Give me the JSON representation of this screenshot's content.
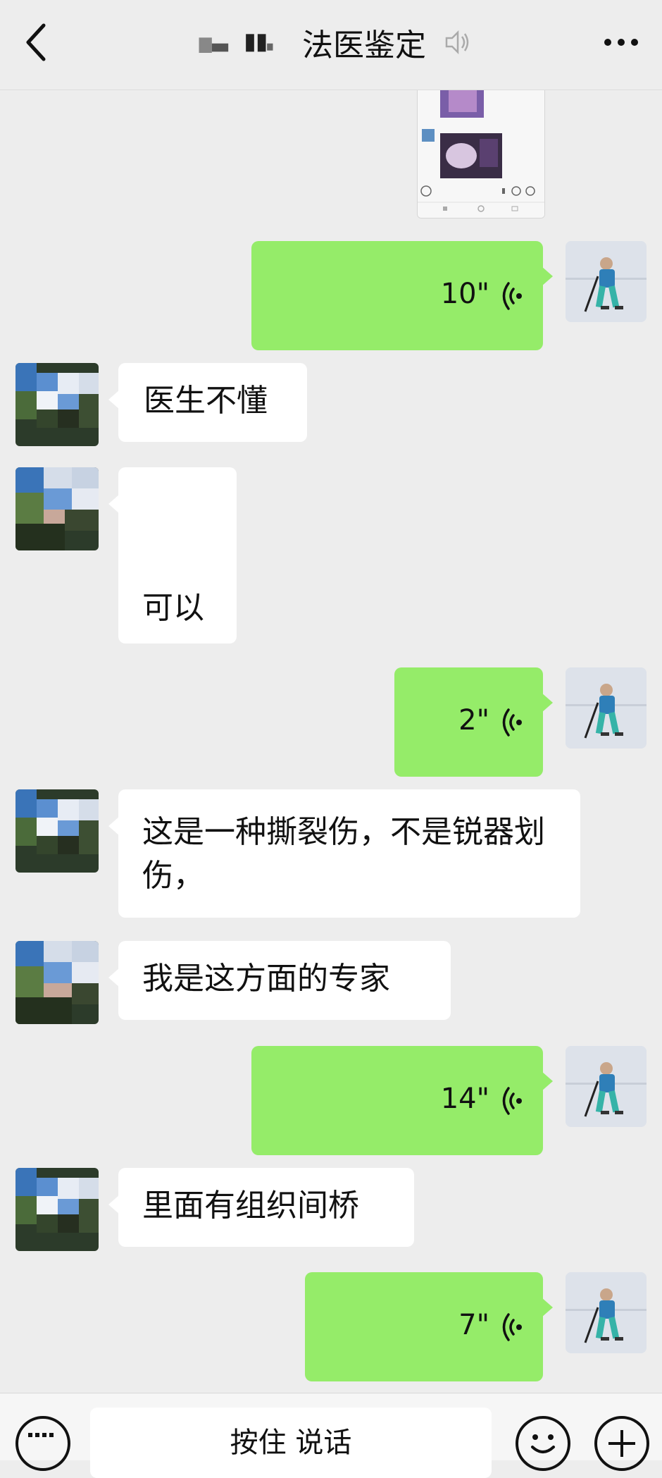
{
  "header": {
    "title": "法医鉴定",
    "back_icon": "chevron-left-icon",
    "mute_icon": "mute-icon",
    "more_icon": "more-icon"
  },
  "colors": {
    "background": "#ededed",
    "self_bubble": "#95ec69",
    "other_bubble": "#ffffff"
  },
  "messages": [
    {
      "side": "right",
      "type": "image"
    },
    {
      "side": "right",
      "type": "voice",
      "duration": "10\""
    },
    {
      "side": "left",
      "type": "text",
      "text": "医生不懂"
    },
    {
      "side": "left",
      "type": "text",
      "text": "可以"
    },
    {
      "side": "right",
      "type": "voice",
      "duration": "2\""
    },
    {
      "side": "left",
      "type": "text",
      "text": "这是一种撕裂伤，不是锐器划伤，"
    },
    {
      "side": "left",
      "type": "text",
      "text": "我是这方面的专家"
    },
    {
      "side": "right",
      "type": "voice",
      "duration": "14\""
    },
    {
      "side": "left",
      "type": "text",
      "text": "里面有组织间桥"
    },
    {
      "side": "right",
      "type": "voice",
      "duration": "7\""
    }
  ],
  "input_bar": {
    "hold_to_talk": "按住 说话",
    "keyboard_icon": "keyboard-icon",
    "emoji_icon": "emoji-icon",
    "plus_icon": "plus-icon"
  }
}
